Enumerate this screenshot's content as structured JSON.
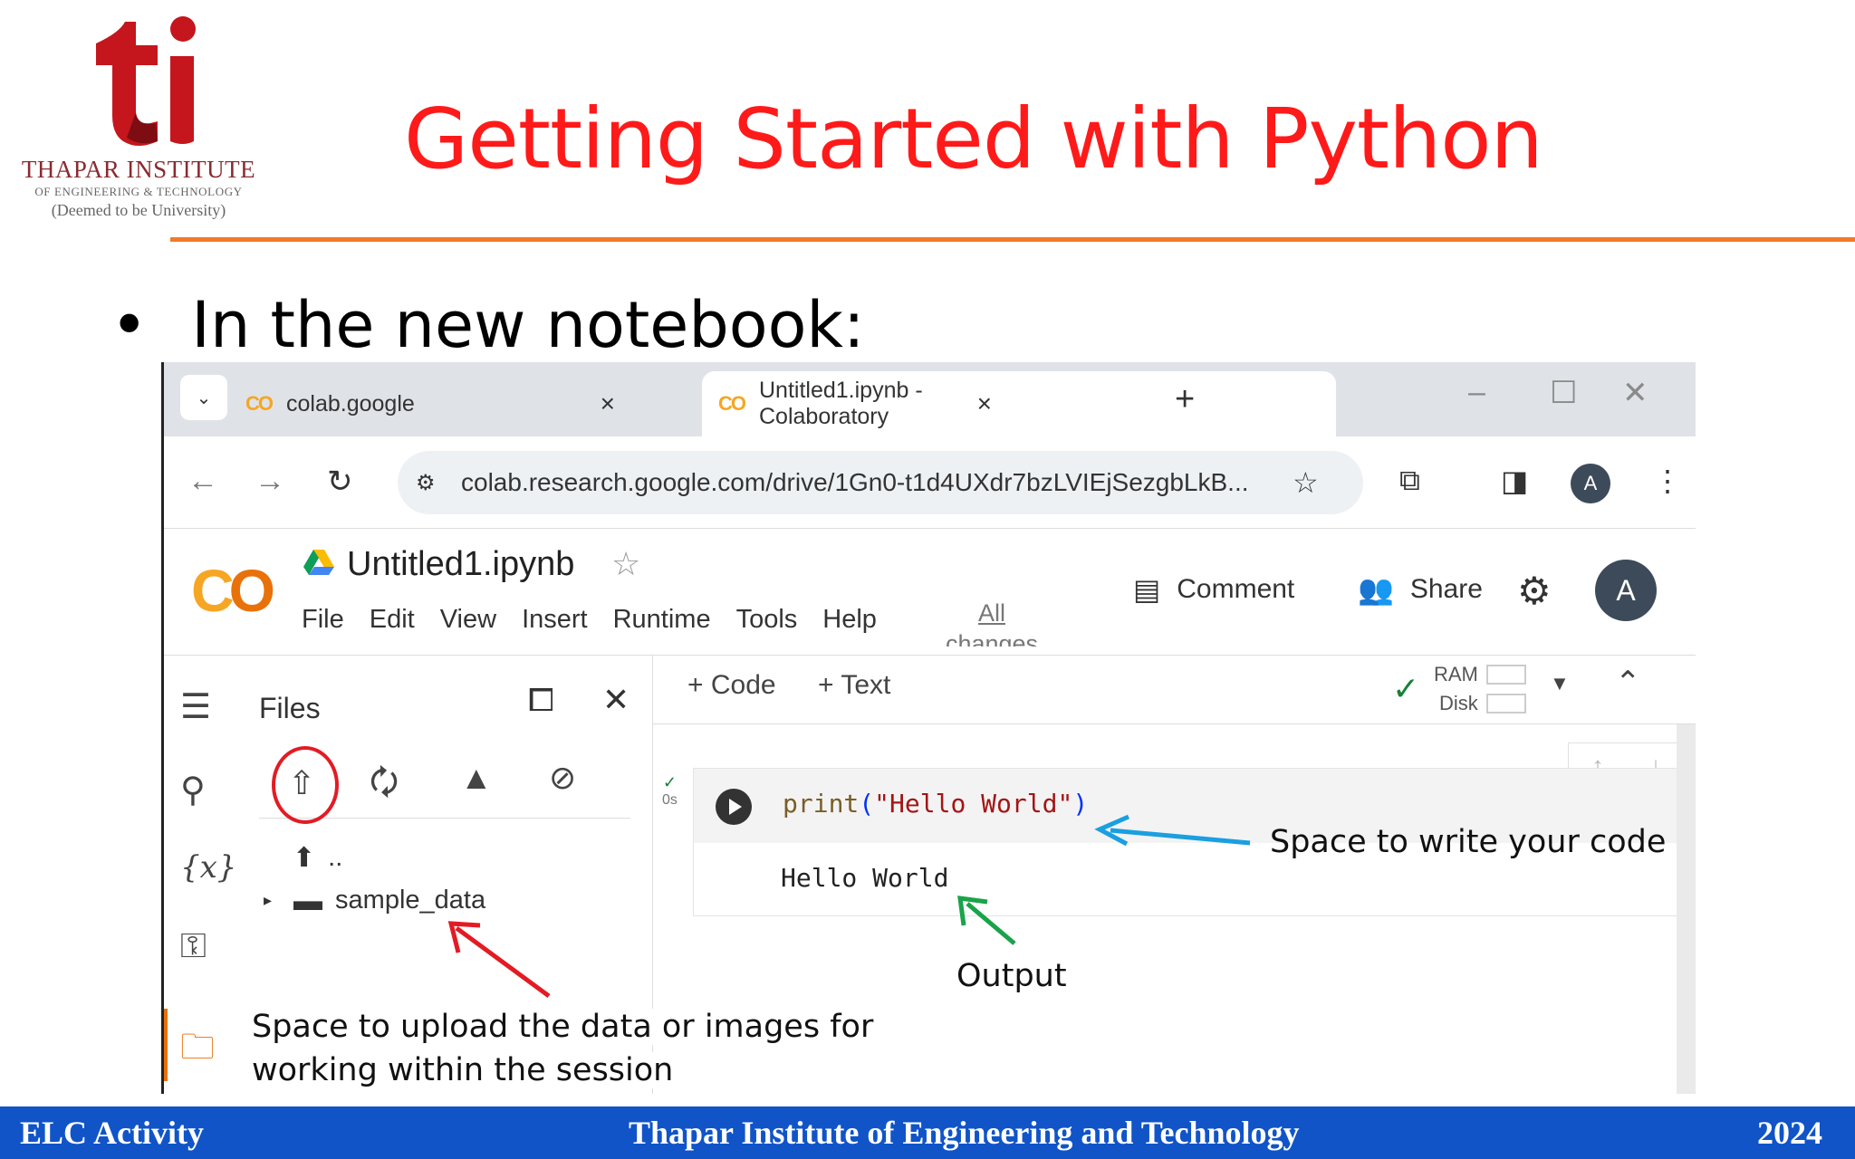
{
  "slide": {
    "logo": {
      "mark": "ti",
      "name": "THAPAR INSTITUTE",
      "subtitle": "OF ENGINEERING & TECHNOLOGY",
      "deemed": "(Deemed to be University)"
    },
    "title": "Getting Started with Python",
    "bullet_symbol": "•",
    "bullet_text": "In the new notebook:",
    "accent_color": "#ff1a1a",
    "rule_color": "#f07a2a"
  },
  "browser": {
    "tabs": [
      {
        "label": "colab.google",
        "active": false
      },
      {
        "label": "Untitled1.ipynb - Colaboratory",
        "active": true
      }
    ],
    "tab_icon": "CO",
    "address": "colab.research.google.com/drive/1Gn0-t1d4UXdr7bzLVIEjSezgbLkB...",
    "profile_initial": "A"
  },
  "colab": {
    "logo": "CO",
    "notebook_title": "Untitled1.ipynb",
    "menu": [
      "File",
      "Edit",
      "View",
      "Insert",
      "Runtime",
      "Tools",
      "Help"
    ],
    "all_changes": "All changes",
    "comment_label": "Comment",
    "share_label": "Share",
    "user_initial": "A",
    "files_panel": {
      "title": "Files",
      "parent_dir": "..",
      "folder": "sample_data"
    },
    "toolbar": {
      "code_label": "+ Code",
      "text_label": "+ Text",
      "ram_label": "RAM",
      "disk_label": "Disk"
    },
    "cell": {
      "exec_time": "0s",
      "code_fn": "print",
      "code_open": "(",
      "code_string": "\"Hello World\"",
      "code_close": ")",
      "output": "Hello World"
    }
  },
  "annotations": {
    "code_space": "Space to write your code",
    "output": "Output",
    "upload_line1": "Space to upload the data or images for",
    "upload_line2": "working within the session",
    "code_arrow_color": "#1a9fe0",
    "output_arrow_color": "#1aa34a",
    "upload_arrow_color": "#e31b23"
  },
  "footer": {
    "left": "ELC Activity",
    "center": "Thapar Institute of Engineering and Technology",
    "right": "2024",
    "color": "#1054c8"
  }
}
